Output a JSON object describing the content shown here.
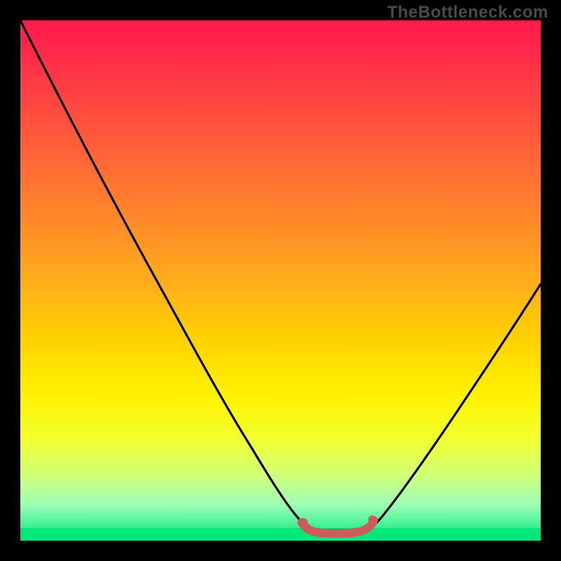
{
  "watermark": "TheBottleneck.com",
  "chart_data": {
    "type": "line",
    "title": "",
    "xlabel": "",
    "ylabel": "",
    "xlim": [
      0,
      100
    ],
    "ylim": [
      0,
      100
    ],
    "grid": false,
    "series": [
      {
        "name": "bottleneck-curve",
        "color": "#000000",
        "x": [
          0,
          6,
          12,
          18,
          24,
          30,
          36,
          42,
          47,
          51,
          54,
          56,
          57,
          59,
          62,
          64,
          67,
          73,
          80,
          88,
          96,
          100
        ],
        "y": [
          100,
          88,
          76,
          64,
          52,
          41,
          30,
          20,
          12,
          6,
          3,
          2,
          2,
          2,
          2,
          2,
          3,
          8,
          16,
          28,
          42,
          50
        ]
      },
      {
        "name": "optimal-band",
        "color": "#cc5c5c",
        "x": [
          54,
          56,
          58,
          60,
          62,
          64,
          66
        ],
        "y": [
          3,
          2,
          2,
          2,
          2,
          2,
          3
        ]
      }
    ],
    "background_gradient": {
      "top": "#ff1a4b",
      "mid": "#fff200",
      "bottom": "#00e87a"
    }
  }
}
